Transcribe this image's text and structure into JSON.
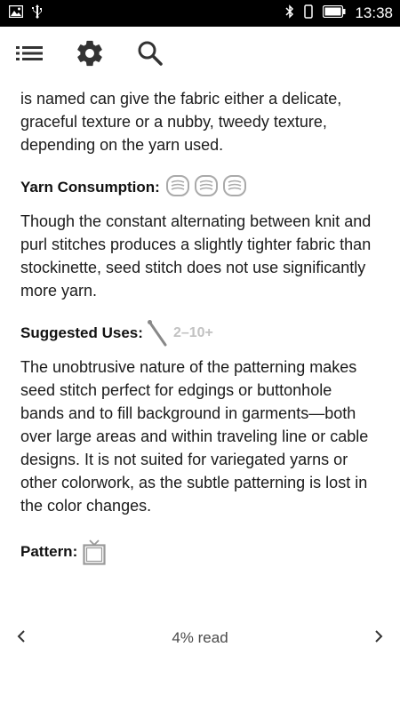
{
  "status_bar": {
    "time": "13:38"
  },
  "paragraphs": {
    "intro": "is named can give the fabric either a delicate, graceful texture or a nubby, tweedy texture, depending on the yarn used.",
    "yarn": "Though the constant alternating between knit and purl stitches produces a slightly tighter fabric than stockinette, seed stitch does not use significantly more yarn.",
    "uses": "The unobtrusive nature of the patterning makes seed stitch perfect for edgings or buttonhole bands and to fill background in garments—both over large areas and within traveling line or cable designs. It is not suited for variegated yarns or other colorwork, as the subtle patterning is lost in the color changes."
  },
  "sections": {
    "yarn_label": "Yarn Consumption:",
    "yarn_skeins": 3,
    "uses_label": "Suggested Uses:",
    "uses_range": "2–10+",
    "pattern_label": "Pattern:"
  },
  "footer": {
    "progress": "4% read"
  }
}
